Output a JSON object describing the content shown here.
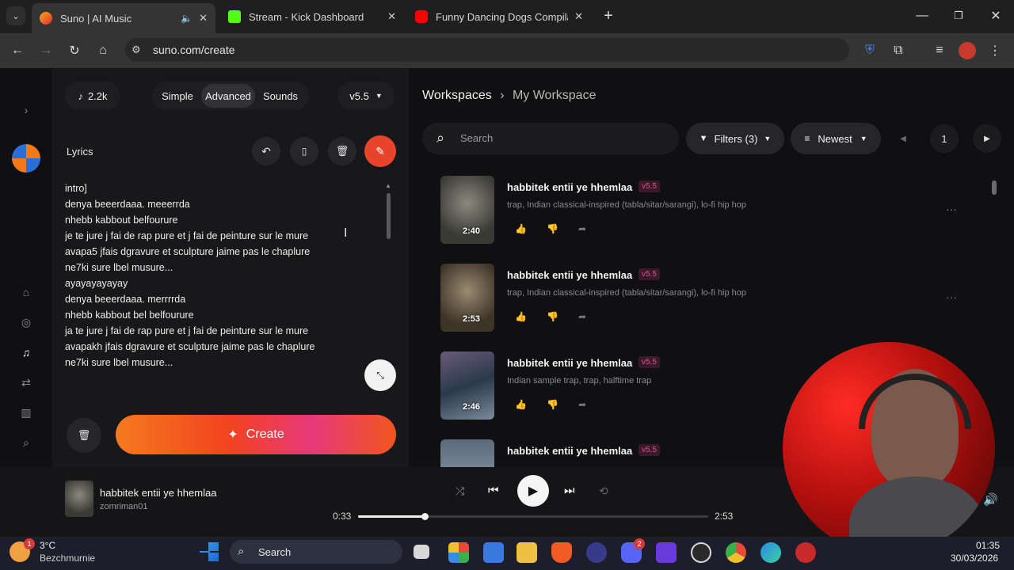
{
  "browser": {
    "tabs": [
      {
        "title": "Suno | AI Music",
        "active": true
      },
      {
        "title": "Stream - Kick Dashboard",
        "active": false
      },
      {
        "title": "Funny Dancing Dogs Compilatio",
        "active": false
      }
    ],
    "url": "suno.com/create"
  },
  "create_panel": {
    "credits": "2.2k",
    "modes": [
      "Simple",
      "Advanced",
      "Sounds"
    ],
    "active_mode": "Advanced",
    "model": "v5.5",
    "lyrics_label": "Lyrics",
    "lyrics": [
      "intro]",
      "denya beeerdaaa. meeerrda",
      "nhebb kabbout belfourure",
      "je te jure j fai  de rap pure et j fai de peinture  sur le mure",
      "avapa5 jfais dgravure et sculpture  jaime pas le chaplure",
      "ne7ki sure lbel musure...",
      "ayayayayayay",
      "denya beeerdaaa. merrrrda",
      "nhebb kabbout bel  belfourure",
      "ja te jure j fai  de rap pure et j fai de peinture  sur le mure",
      "avapakh jfais dgravure et sculpture  jaime pas le chaplure",
      "ne7ki sure lbel musure..."
    ],
    "create_label": "Create"
  },
  "workspace": {
    "breadcrumb_root": "Workspaces",
    "breadcrumb_current": "My Workspace",
    "search_placeholder": "Search",
    "filters_label": "Filters (3)",
    "sort_label": "Newest",
    "page": "1",
    "songs": [
      {
        "title": "habbitek entii ye hhemlaa",
        "version": "v5.5",
        "tags": "trap, Indian classical-inspired (tabla/sitar/sarangi), lo-fi hip hop",
        "duration": "2:40"
      },
      {
        "title": "habbitek entii ye hhemlaa",
        "version": "v5.5",
        "tags": "trap, Indian classical-inspired (tabla/sitar/sarangi), lo-fi hip hop",
        "duration": "2:53"
      },
      {
        "title": "habbitek entii ye hhemlaa",
        "version": "v5.5",
        "tags": "Indian sample trap, trap, halftime trap",
        "duration": "2:46"
      },
      {
        "title": "habbitek entii ye hhemlaa",
        "version": "v5.5",
        "tags": "",
        "duration": ""
      }
    ]
  },
  "player": {
    "title": "habbitek entii ye hhemlaa",
    "artist": "zomriman01",
    "elapsed": "0:33",
    "total": "2:53",
    "progress": 0.19
  },
  "taskbar": {
    "weather_temp": "3°C",
    "weather_place": "Bezchmurnie",
    "search_label": "Search",
    "time": "01:35",
    "date": "30/03/2026",
    "weather_badge": "1",
    "discord_badge": "2"
  },
  "colors": {
    "accent": "#f2431f",
    "background": "#101012",
    "panel": "#18181a"
  }
}
